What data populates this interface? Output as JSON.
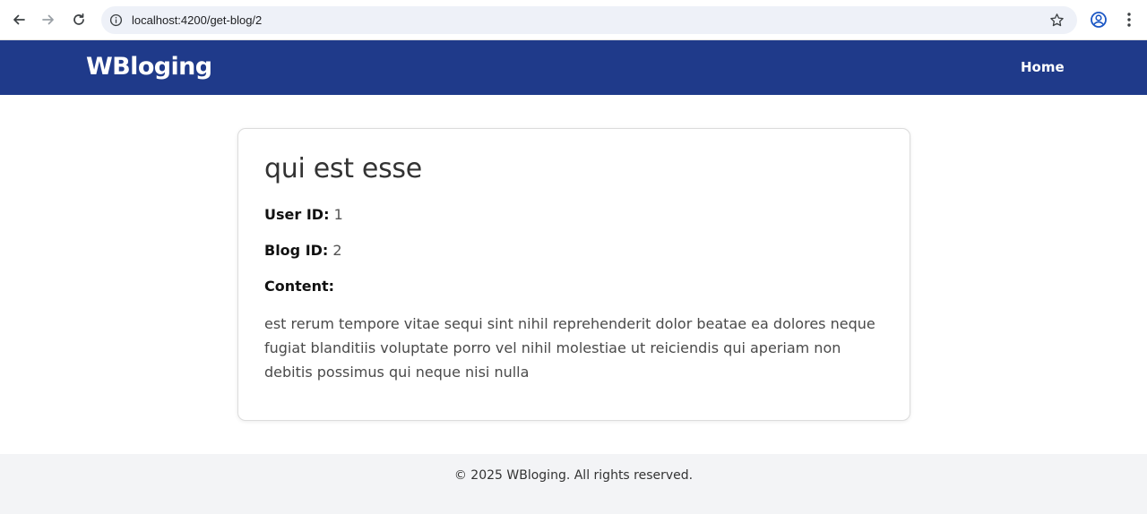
{
  "browser": {
    "url": "localhost:4200/get-blog/2",
    "icons": [
      "back-arrow-icon",
      "forward-arrow-icon",
      "reload-icon",
      "info-icon",
      "star-icon",
      "profile-icon",
      "kebab-menu-icon"
    ]
  },
  "header": {
    "brand": "WBloging",
    "nav": {
      "home_label": "Home"
    },
    "background_color": "#1f3a8a"
  },
  "post": {
    "title": "qui est esse",
    "user_id_label": "User ID:",
    "user_id_value": "1",
    "blog_id_label": "Blog ID:",
    "blog_id_value": "2",
    "content_label": "Content:",
    "body": "est rerum tempore vitae sequi sint nihil reprehenderit dolor beatae ea dolores neque fugiat blanditiis voluptate porro vel nihil molestiae ut reiciendis qui aperiam non debitis possimus qui neque nisi nulla"
  },
  "footer": {
    "copyright": "© 2025 WBloging. All rights reserved.",
    "background_color": "#f3f4f6"
  }
}
